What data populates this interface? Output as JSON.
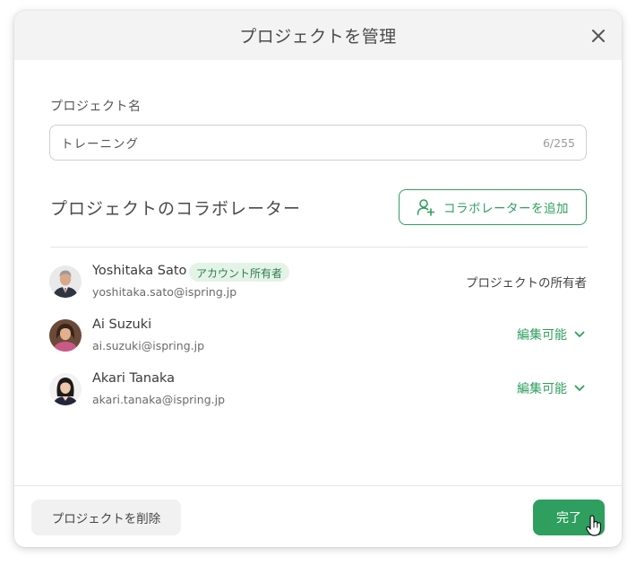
{
  "dialog": {
    "title": "プロジェクトを管理",
    "close_icon": "close-icon"
  },
  "project_name": {
    "label": "プロジェクト名",
    "value": "トレーニング",
    "counter": "6/255"
  },
  "collaborators": {
    "section_title": "プロジェクトのコラボレーター",
    "add_button_label": "コラボレーターを追加",
    "add_button_icon": "add-user-icon",
    "users": [
      {
        "name": "Yoshitaka Sato",
        "email": "yoshitaka.sato@ispring.jp",
        "badge": "アカウント所有者",
        "role": "プロジェクトの所有者",
        "role_editable": false
      },
      {
        "name": "Ai Suzuki",
        "email": "ai.suzuki@ispring.jp",
        "role": "編集可能",
        "role_editable": true
      },
      {
        "name": "Akari Tanaka",
        "email": "akari.tanaka@ispring.jp",
        "role": "編集可能",
        "role_editable": true
      }
    ]
  },
  "footer": {
    "delete_label": "プロジェクトを削除",
    "done_label": "完了"
  },
  "colors": {
    "accent": "#2e9f5e",
    "badge_bg": "#e3f3e8",
    "header_bg": "#f3f3f3"
  }
}
